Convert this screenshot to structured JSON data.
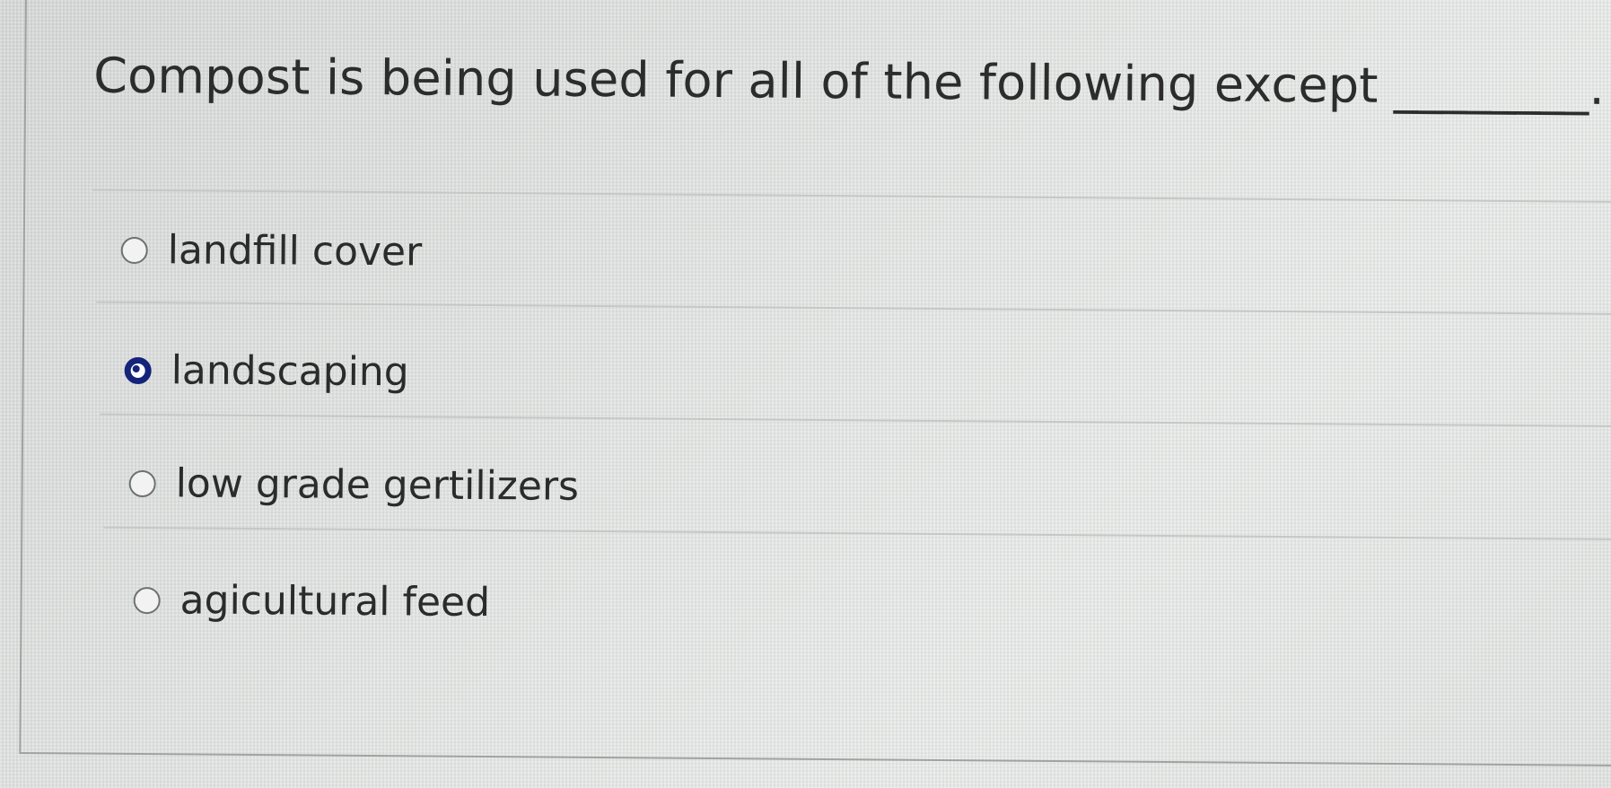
{
  "question": {
    "text": "Compost is being used for all of the following except ________."
  },
  "options": [
    {
      "label": "landfill cover",
      "selected": false
    },
    {
      "label": "landscaping",
      "selected": true
    },
    {
      "label": "low grade gertilizers",
      "selected": false
    },
    {
      "label": "agicultural feed",
      "selected": false
    }
  ],
  "colors": {
    "selected_radio": "#15247a",
    "text": "#2c2c2c"
  }
}
